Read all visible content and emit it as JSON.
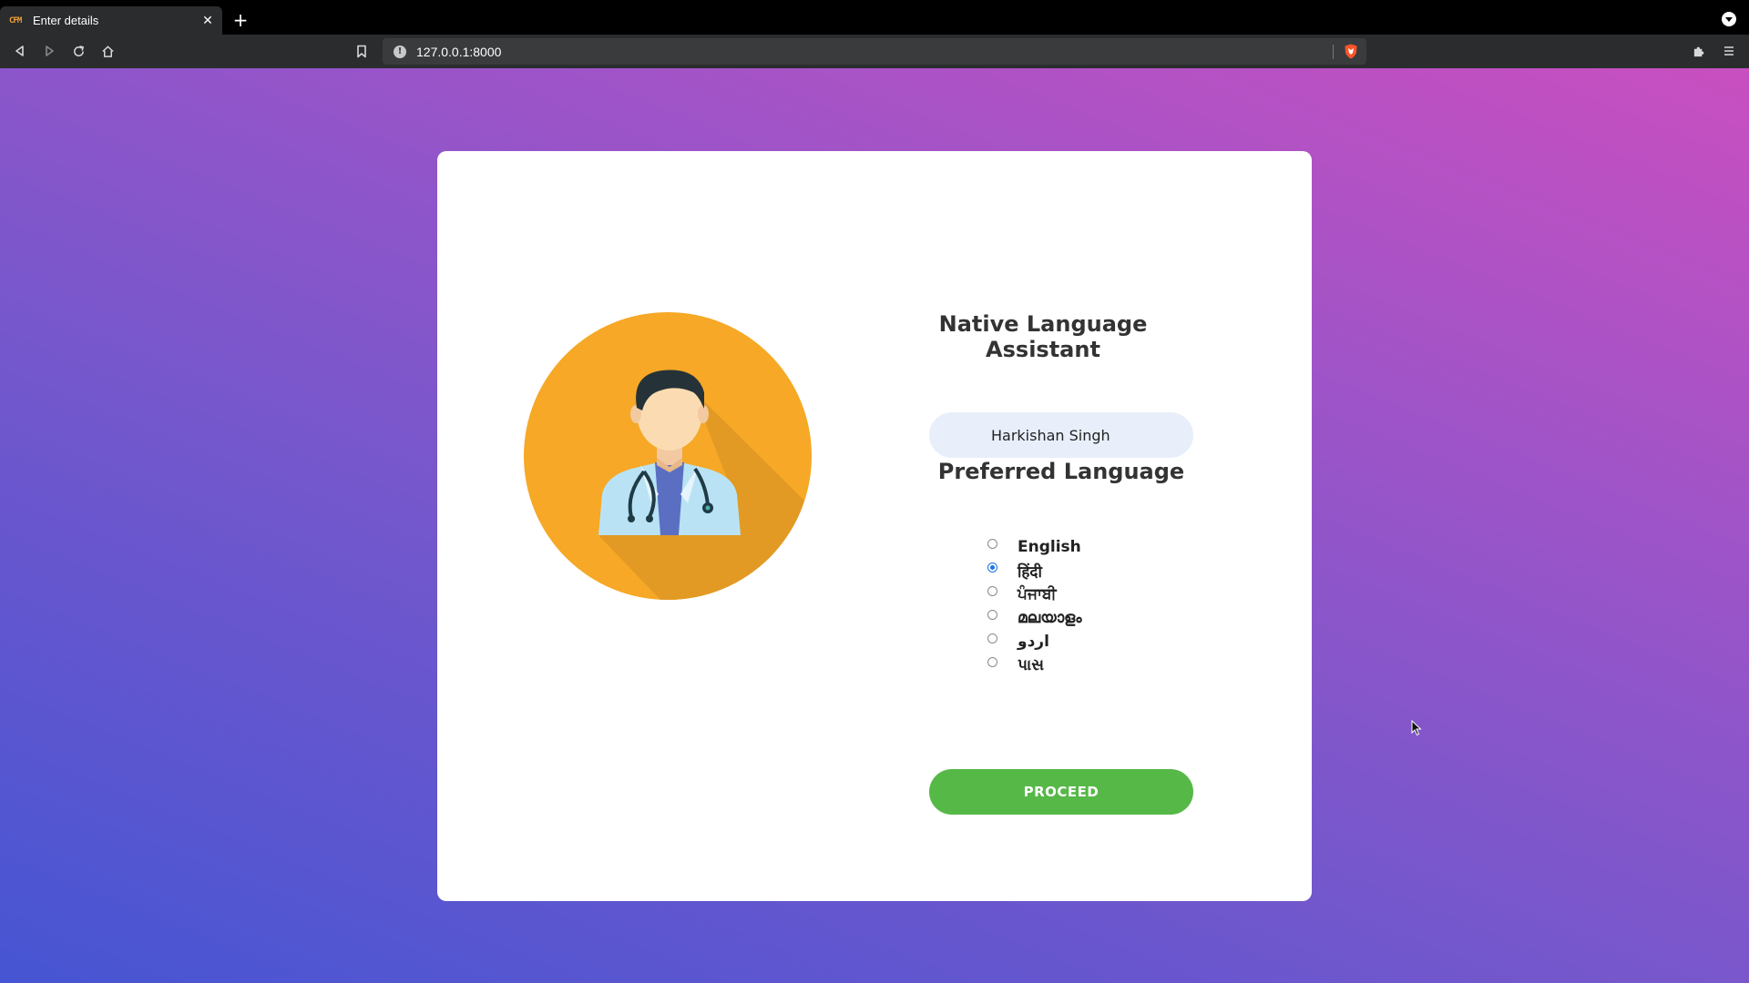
{
  "browser": {
    "tab_title": "Enter details",
    "favicon_text": "CFM",
    "tab_close": "✕",
    "new_tab": "+",
    "url": "127.0.0.1:8000",
    "url_info": "!"
  },
  "form": {
    "title": "Native Language Assistant",
    "name_value": "Harkishan Singh",
    "preferred_language_heading": "Preferred Language",
    "languages": [
      {
        "label": "English",
        "selected": false
      },
      {
        "label": "हिंदी",
        "selected": true
      },
      {
        "label": "ਪੰਜਾਬੀ",
        "selected": false
      },
      {
        "label": "മലയാളം",
        "selected": false
      },
      {
        "label": "اردو",
        "selected": false
      },
      {
        "label": "પાસ",
        "selected": false
      }
    ],
    "proceed_label": "PROCEED"
  },
  "colors": {
    "avatar_circle": "#f6a826",
    "proceed_button": "#56b847",
    "radio_selected": "#1a73e8"
  }
}
